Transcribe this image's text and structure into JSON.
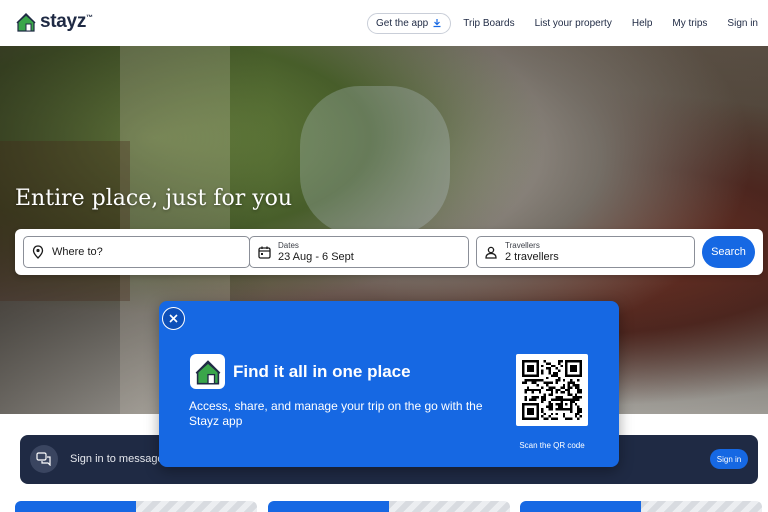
{
  "brand": {
    "name": "stayz",
    "trademark": "™",
    "accent": "#1668e3",
    "navy": "#1f2a44"
  },
  "nav": {
    "get_app": "Get the app",
    "items": [
      "Trip Boards",
      "List your property",
      "Help",
      "My trips",
      "Sign in"
    ]
  },
  "hero": {
    "title": "Entire place, just for you"
  },
  "search": {
    "where_placeholder": "Where to?",
    "dates_label": "Dates",
    "dates_value": "23 Aug - 6 Sept",
    "travellers_label": "Travellers",
    "travellers_value": "2 travellers",
    "button": "Search"
  },
  "banner": {
    "message": "Sign in to message",
    "button": "Sign in"
  },
  "modal": {
    "title": "Find it all in one place",
    "description": "Access, share, and manage your trip on the go with the Stayz app",
    "qr_caption": "Scan the QR code",
    "icons": {
      "close": "close-icon",
      "app": "stayz-house-icon",
      "qr": "qr-code"
    }
  }
}
